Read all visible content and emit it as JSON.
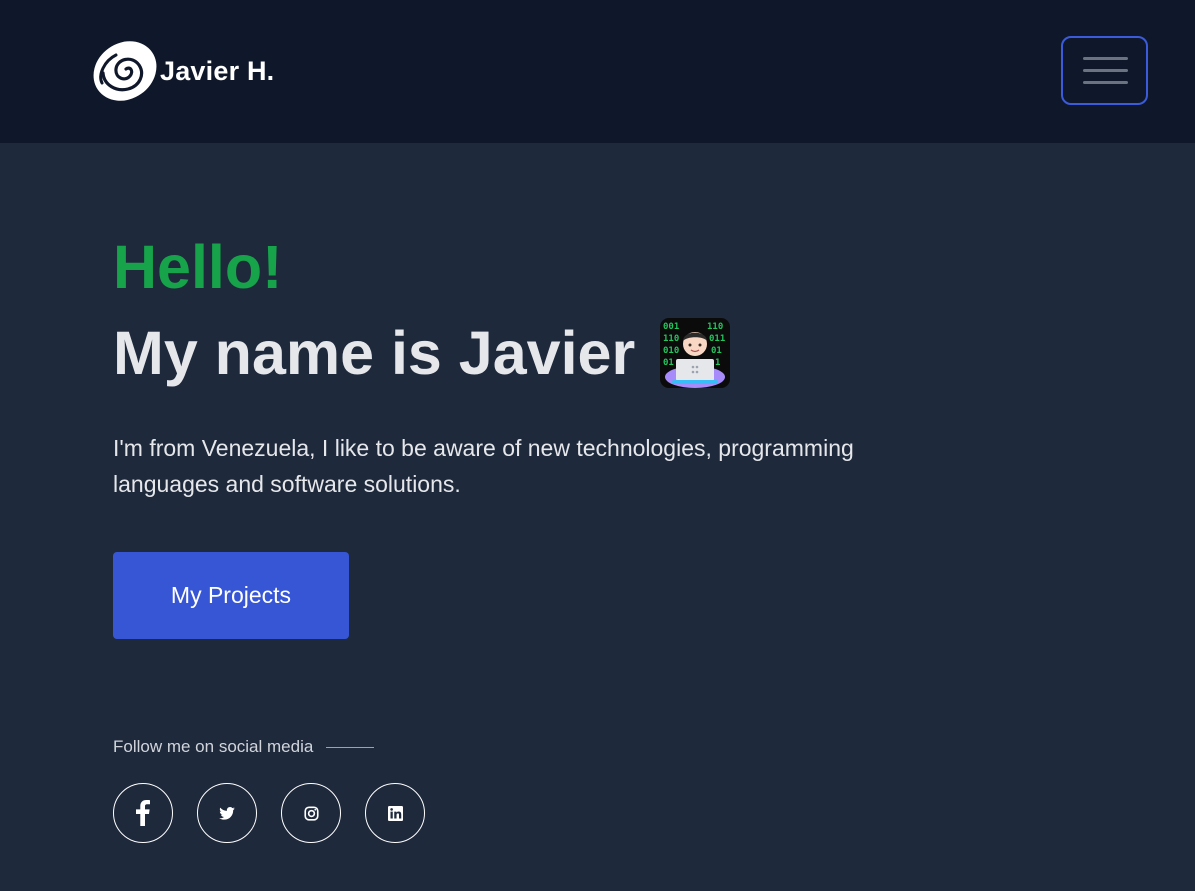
{
  "navbar": {
    "brand_name": "Javier H.",
    "logo_icon": "swirl-logo-icon",
    "menu_icon": "hamburger-menu-icon"
  },
  "hero": {
    "greeting": "Hello!",
    "headline": "My name is Javier",
    "headline_icon": "technologist-emoji-icon",
    "bio": "I'm from Venezuela, I like to be aware of new technologies, programming languages and software solutions.",
    "cta_label": "My Projects"
  },
  "social": {
    "label": "Follow me on social media",
    "links": [
      {
        "icon": "facebook-icon"
      },
      {
        "icon": "twitter-icon"
      },
      {
        "icon": "instagram-icon"
      },
      {
        "icon": "linkedin-icon"
      }
    ]
  },
  "colors": {
    "navbar_bg": "#0f172a",
    "page_bg": "#1e293b",
    "accent_green": "#16a34a",
    "button_blue": "#3656d6",
    "menu_border": "#3b5bdb"
  }
}
